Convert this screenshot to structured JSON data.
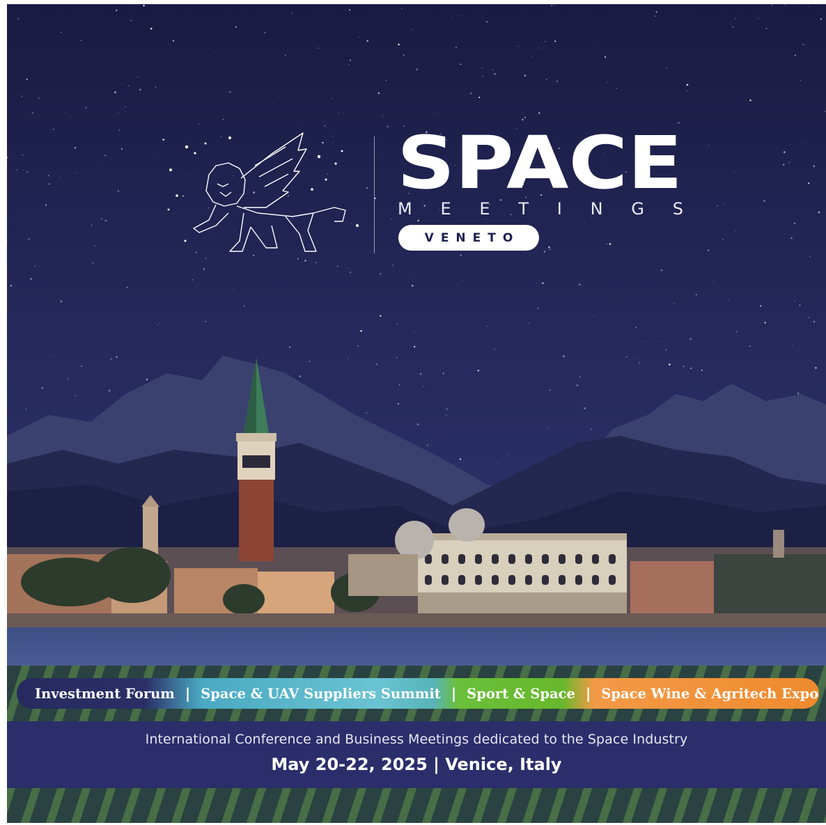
{
  "logo": {
    "word": "SPACE",
    "meetings_letters": [
      "M",
      "E",
      "E",
      "T",
      "I",
      "N",
      "G",
      "S"
    ],
    "badge": "VENETO",
    "emblem": "winged-lion-constellation-icon"
  },
  "tracks": [
    {
      "label": "Investment Forum",
      "color": "#272a5f"
    },
    {
      "label": "Space & UAV Suppliers Summit",
      "color": "#5bbdd0"
    },
    {
      "label": "Sport & Space",
      "color": "#6bbf3a"
    },
    {
      "label": "Space Wine & Agritech Expo",
      "color": "#ef8a2e"
    }
  ],
  "track_separator": "|",
  "event": {
    "subtitle": "International Conference and Business Meetings dedicated to the Space Industry",
    "dates_location": "May 20-22, 2025 | Venice, Italy"
  },
  "colors": {
    "night_sky": "#1c1d44",
    "info_band": "#2c2e6b",
    "campanile_brick": "#8c4535",
    "palace_stone": "#d8cfbc"
  }
}
